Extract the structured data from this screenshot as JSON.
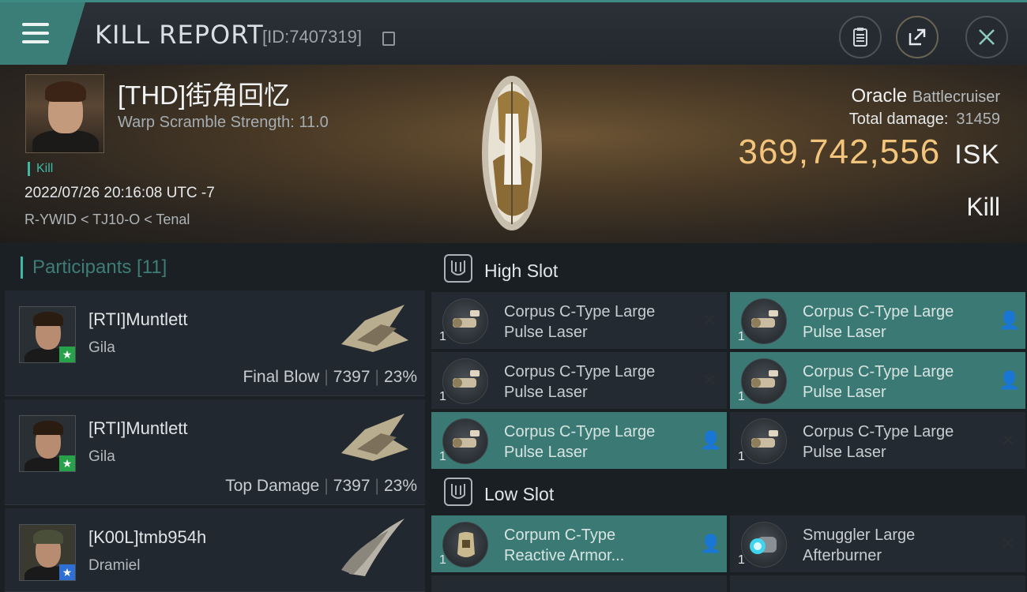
{
  "header": {
    "title": "KILL REPORT",
    "report_id": "[ID:7407319]"
  },
  "victim": {
    "name": "[THD]街角回忆",
    "warp_scramble": "Warp Scramble Strength: 11.0",
    "kill_tag": "Kill",
    "timestamp": "2022/07/26 20:16:08 UTC -7",
    "location": "R-YWID < TJ10-O < Tenal"
  },
  "ship": {
    "name": "Oracle",
    "class": "Battlecruiser",
    "total_damage_label": "Total damage:",
    "total_damage": "31459",
    "isk_value": "369,742,556",
    "isk_unit": "ISK",
    "result": "Kill"
  },
  "participants": {
    "title": "Participants [11]",
    "rows": [
      {
        "name": "[RTI]Muntlett",
        "ship": "Gila",
        "tag": "Final Blow",
        "damage": "7397",
        "percent": "23%",
        "badge": "★"
      },
      {
        "name": "[RTI]Muntlett",
        "ship": "Gila",
        "tag": "Top Damage",
        "damage": "7397",
        "percent": "23%",
        "badge": "★"
      },
      {
        "name": "[K00L]tmb954h",
        "ship": "Dramiel",
        "tag": "",
        "damage": "",
        "percent": "",
        "badge": "★"
      }
    ]
  },
  "slots": {
    "high": {
      "title": "High Slot",
      "modules": [
        {
          "line1": "Corpus C-Type Large",
          "line2": "Pulse Laser",
          "qty": "1",
          "status_icon": "x-icon"
        },
        {
          "line1": "Corpus C-Type Large",
          "line2": "Pulse Laser",
          "qty": "1",
          "status_icon": "user-icon"
        },
        {
          "line1": "Corpus C-Type Large",
          "line2": "Pulse Laser",
          "qty": "1",
          "status_icon": "x-icon"
        },
        {
          "line1": "Corpus C-Type Large",
          "line2": "Pulse Laser",
          "qty": "1",
          "status_icon": "user-icon"
        },
        {
          "line1": "Corpus C-Type Large",
          "line2": "Pulse Laser",
          "qty": "1",
          "status_icon": "user-icon"
        },
        {
          "line1": "Corpus C-Type Large",
          "line2": "Pulse Laser",
          "qty": "1",
          "status_icon": "x-icon"
        }
      ]
    },
    "low": {
      "title": "Low Slot",
      "modules": [
        {
          "line1": "Corpum C-Type",
          "line2": "Reactive Armor...",
          "qty": "1",
          "status_icon": "user-icon"
        },
        {
          "line1": "Smuggler Large",
          "line2": "Afterburner",
          "qty": "1",
          "status_icon": "x-icon"
        }
      ]
    }
  },
  "status_glyphs": {
    "x": "✕",
    "user": "👤"
  },
  "colors": {
    "accent": "#3fb8a6",
    "isk": "#f3c57c",
    "highlight_row": "#3b7a74"
  }
}
